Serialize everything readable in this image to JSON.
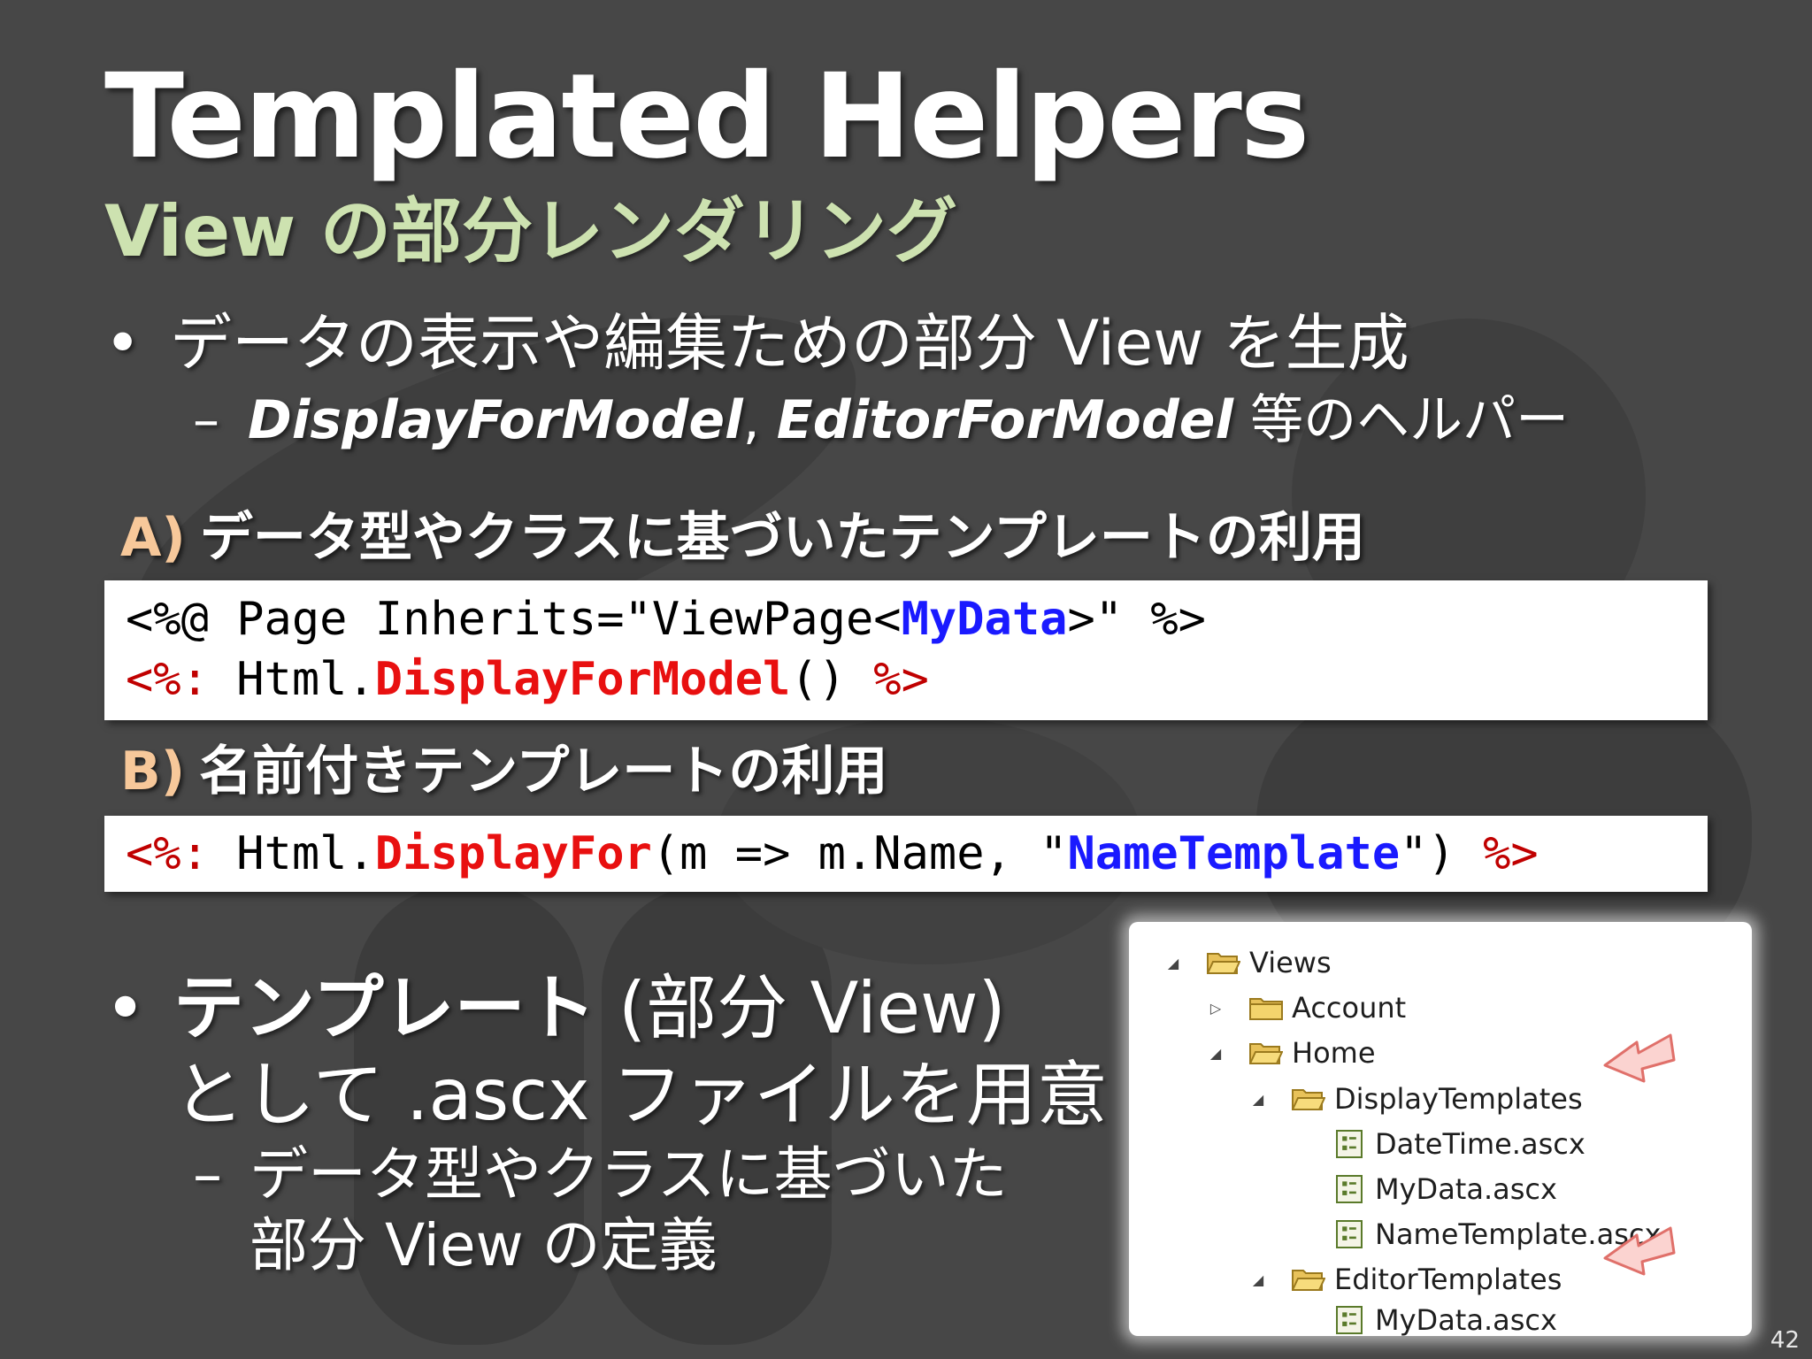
{
  "slide": {
    "title": "Templated Helpers",
    "subtitle": "View の部分レンダリング",
    "bullet1": {
      "marker": "•",
      "text": "データの表示や編集ための部分 View を生成"
    },
    "sub1": {
      "dash": "–",
      "strong1": "DisplayForModel",
      "sep": ", ",
      "strong2": "EditorForModel",
      "rest": " 等のヘルパー"
    },
    "sectionA": {
      "letter": "A)",
      "heading": "データ型やクラスに基づいたテンプレートの利用"
    },
    "codeA": {
      "line1_part1": "<%@ Page Inherits=\"ViewPage<",
      "line1_type": "MyData",
      "line1_part2": ">\" %>",
      "line2_open": "<%:",
      "line2_mid": " Html.",
      "line2_method": "DisplayForModel",
      "line2_args": "() ",
      "line2_close": "%>"
    },
    "sectionB": {
      "letter": "B)",
      "heading": "名前付きテンプレートの利用"
    },
    "codeB": {
      "open": "<%:",
      "mid": " Html.",
      "method": "DisplayFor",
      "args1": "(m => m.Name, \"",
      "template": "NameTemplate",
      "args2": "\") ",
      "close": "%>"
    },
    "bullet2": {
      "marker": "•",
      "strong": "テンプレート",
      "rest": " (部分 View)",
      "line2": "として .ascx ファイルを用意"
    },
    "sub2": {
      "dash": "–",
      "line1": "データ型やクラスに基づいた",
      "line2": "部分 View の定義"
    },
    "page_number": "42"
  },
  "tree": {
    "items": [
      {
        "label": "Views",
        "expander": "◢",
        "icon": "folder-open-icon"
      },
      {
        "label": "Account",
        "expander": "▷",
        "icon": "folder-icon"
      },
      {
        "label": "Home",
        "expander": "◢",
        "icon": "folder-open-icon"
      },
      {
        "label": "DisplayTemplates",
        "expander": "◢",
        "icon": "folder-open-icon"
      },
      {
        "label": "DateTime.ascx",
        "expander": "",
        "icon": "ascx-file-icon"
      },
      {
        "label": "MyData.ascx",
        "expander": "",
        "icon": "ascx-file-icon"
      },
      {
        "label": "NameTemplate.ascx",
        "expander": "",
        "icon": "ascx-file-icon"
      },
      {
        "label": "EditorTemplates",
        "expander": "◢",
        "icon": "folder-open-icon"
      },
      {
        "label": "MyData.ascx",
        "expander": "",
        "icon": "ascx-file-icon"
      }
    ]
  },
  "colors": {
    "background": "#474747",
    "subtitle": "#cde2b0",
    "section_letter": "#f7c89a",
    "code_red": "#c00000",
    "code_method": "#e81010",
    "code_blue": "#1a1aff",
    "arrow_fill": "#fbd3d0",
    "arrow_stroke": "#e0706a"
  }
}
